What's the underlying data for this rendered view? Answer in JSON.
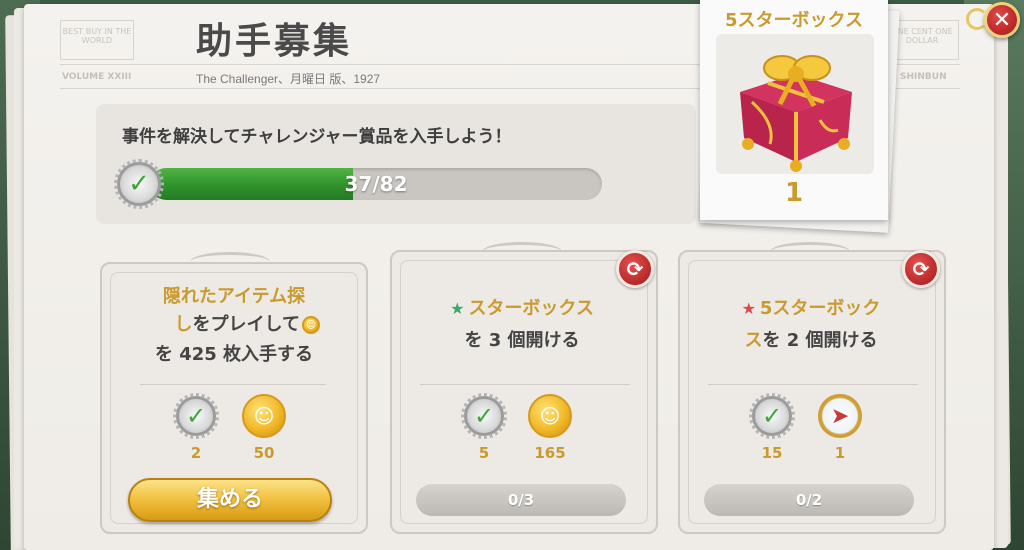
{
  "page": {
    "title": "助手募集",
    "subtitle": "The Challenger、月曜日 版、1927",
    "masthead_left": "BEST BUY IN THE WORLD",
    "masthead_right": "ONE CENT ONE DOLLAR",
    "strip_left": "VOLUME XXIII",
    "strip_right": "SHINBUN"
  },
  "progress": {
    "caption": "事件を解決してチャレンジャー賞品を入手しよう！",
    "current": 37,
    "total": 82,
    "text": "37/82",
    "fill_fraction": 0.45
  },
  "prize": {
    "title": "5スターボックス",
    "count": "1",
    "icon": "gift-box-icon"
  },
  "close_button": {
    "icon": "close-icon",
    "label": "✕"
  },
  "tasks": [
    {
      "line1": "隠れたアイテム探",
      "line2_gold": "し",
      "line2": "をプレイして",
      "line3": "を 425 枚入手する",
      "rewards": [
        {
          "icon": "check-badge-icon",
          "value": "2"
        },
        {
          "icon": "coin-icon",
          "value": "50"
        }
      ],
      "button_label": "集める"
    },
    {
      "line1_gold": "スターボックス",
      "line2": "を 3 個開ける",
      "rewards": [
        {
          "icon": "check-badge-icon",
          "value": "5"
        },
        {
          "icon": "coin-icon",
          "value": "165"
        }
      ],
      "progress_text": "0/3",
      "icon": "green-star-icon"
    },
    {
      "line1_gold": "5スターボック",
      "line2_gold": "ス",
      "line2": "を 2 個開ける",
      "rewards": [
        {
          "icon": "check-badge-icon",
          "value": "15"
        },
        {
          "icon": "compass-icon",
          "value": "1"
        }
      ],
      "progress_text": "0/2",
      "icon": "red-star-icon"
    }
  ],
  "colors": {
    "gold": "#c99a2e",
    "progress_green": "#2e8f2b",
    "close_red": "#a81616"
  }
}
